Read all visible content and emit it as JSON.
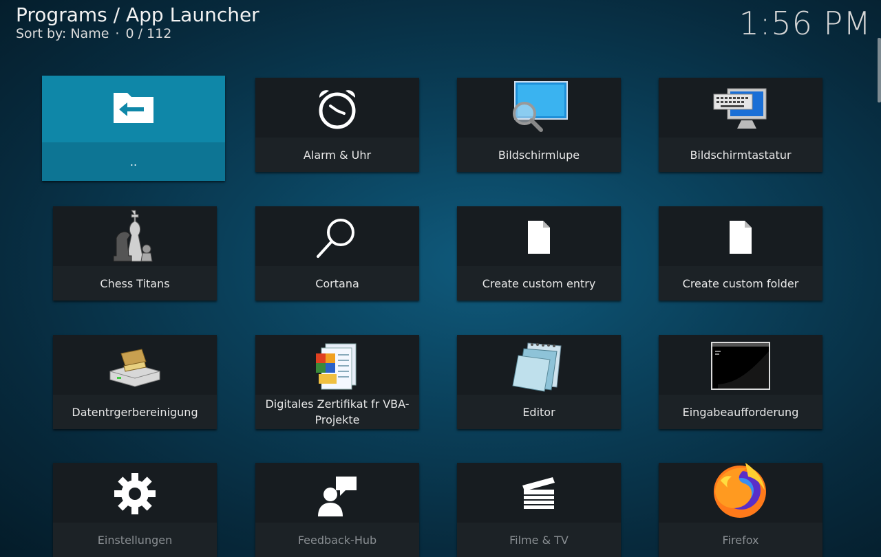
{
  "header": {
    "title": "Programs / App Launcher",
    "sort_label": "Sort by: Name",
    "separator": "·",
    "position": "0 / 112"
  },
  "clock": "1:56 PM",
  "items": [
    {
      "label": "..",
      "icon": "back-folder-icon"
    },
    {
      "label": "Alarm & Uhr",
      "icon": "alarm-clock-icon"
    },
    {
      "label": "Bildschirmlupe",
      "icon": "magnifier-icon"
    },
    {
      "label": "Bildschirmtastatur",
      "icon": "on-screen-keyboard-icon"
    },
    {
      "label": "Chess Titans",
      "icon": "chess-icon"
    },
    {
      "label": "Cortana",
      "icon": "search-icon"
    },
    {
      "label": "Create custom entry",
      "icon": "file-icon"
    },
    {
      "label": "Create custom folder",
      "icon": "file-icon"
    },
    {
      "label": "Datentrgerbereinigung",
      "icon": "disk-cleanup-icon"
    },
    {
      "label": "Digitales Zertifikat fr VBA-Projekte",
      "icon": "certificate-icon"
    },
    {
      "label": "Editor",
      "icon": "notepad-icon"
    },
    {
      "label": "Eingabeaufforderung",
      "icon": "command-prompt-icon"
    },
    {
      "label": "Einstellungen",
      "icon": "gear-icon"
    },
    {
      "label": "Feedback-Hub",
      "icon": "feedback-icon"
    },
    {
      "label": "Filme & TV",
      "icon": "clapperboard-icon"
    },
    {
      "label": "Firefox",
      "icon": "firefox-icon"
    }
  ],
  "colors": {
    "focus": "#0f7fa0",
    "tile": "#1a1f23"
  }
}
